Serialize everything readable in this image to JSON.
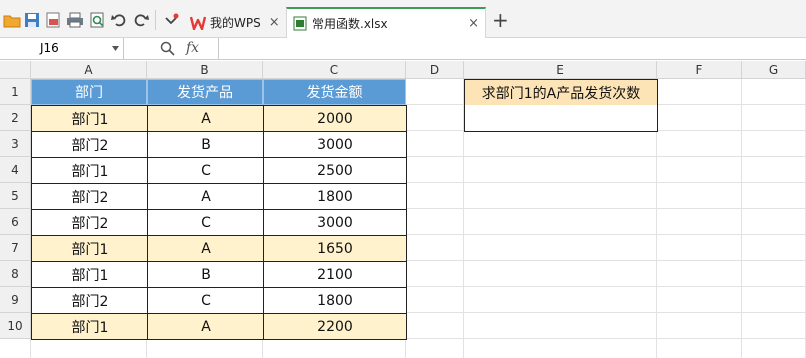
{
  "tabs": [
    {
      "label": "我的WPS"
    },
    {
      "label": "常用函数.xlsx"
    }
  ],
  "tab_close": "×",
  "new_tab": "+",
  "name_box": "J16",
  "fx_label": "fx",
  "columns": [
    "A",
    "B",
    "C",
    "D",
    "E",
    "F",
    "G"
  ],
  "rows": [
    "1",
    "2",
    "3",
    "4",
    "5",
    "6",
    "7",
    "8",
    "9",
    "10"
  ],
  "table": {
    "headers": [
      "部门",
      "发货产品",
      "发货金额"
    ],
    "rows": [
      [
        "部门1",
        "A",
        "2000"
      ],
      [
        "部门2",
        "B",
        "3000"
      ],
      [
        "部门1",
        "C",
        "2500"
      ],
      [
        "部门2",
        "A",
        "1800"
      ],
      [
        "部门2",
        "C",
        "3000"
      ],
      [
        "部门1",
        "A",
        "1650"
      ],
      [
        "部门1",
        "B",
        "2100"
      ],
      [
        "部门2",
        "C",
        "1800"
      ],
      [
        "部门1",
        "A",
        "2200"
      ]
    ]
  },
  "question": "求部门1的A产品发货次数",
  "colors": {
    "header_bg": "#5b9bd5",
    "highlight_bg": "#fff2cc",
    "question_bg": "#fce4b6",
    "wps_red": "#e53935",
    "xlsx_green": "#2e7d32"
  }
}
